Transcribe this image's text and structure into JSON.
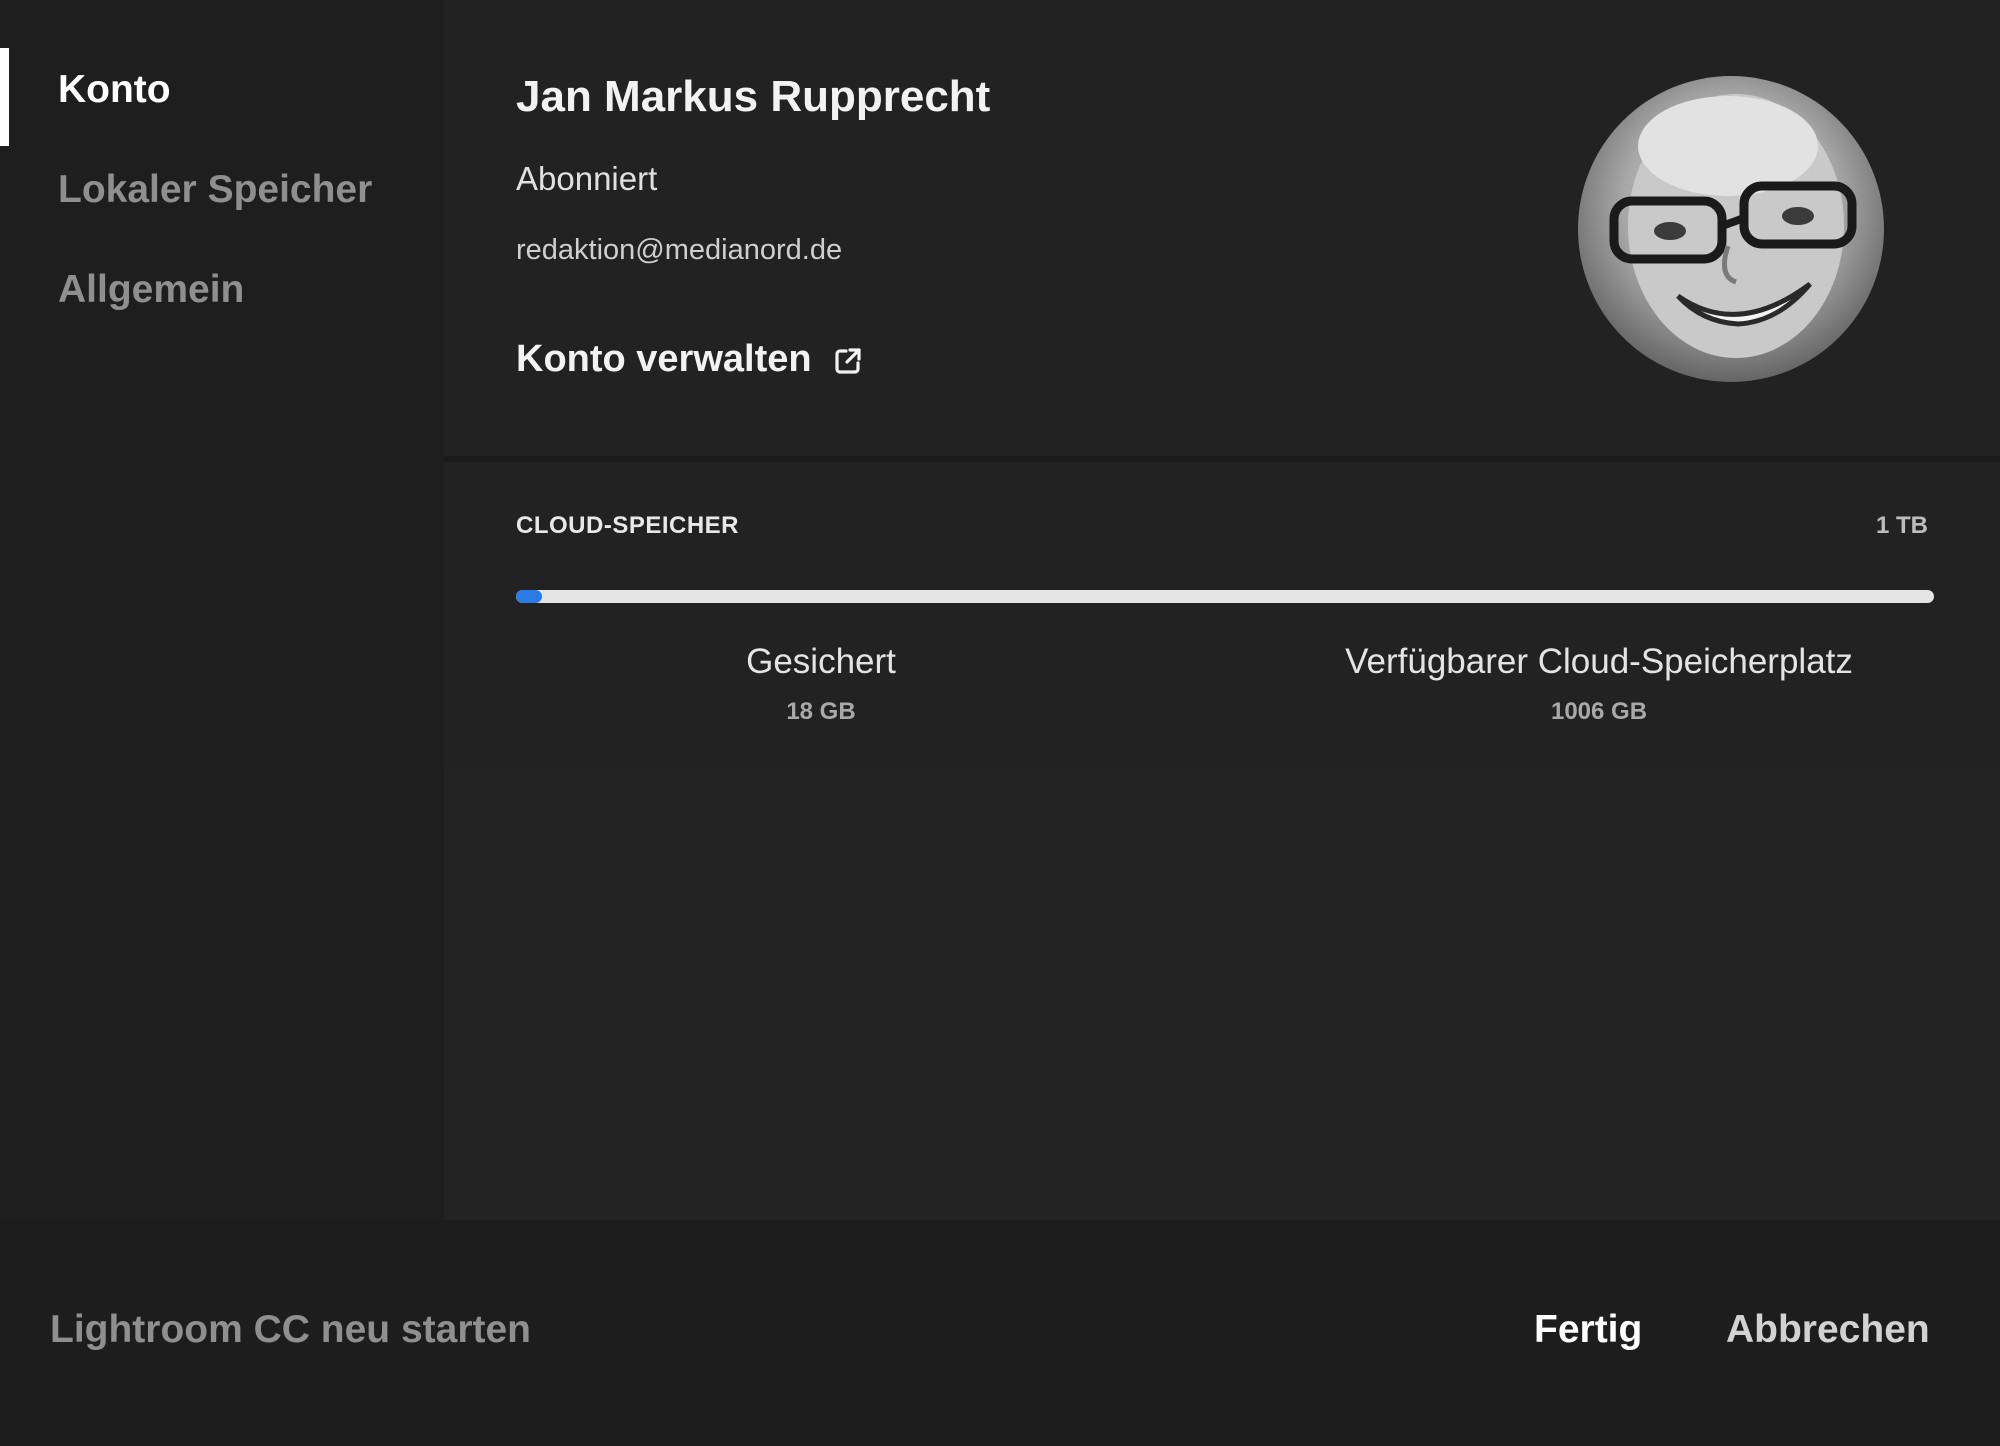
{
  "sidebar": {
    "items": [
      {
        "label": "Konto",
        "active": true
      },
      {
        "label": "Lokaler Speicher",
        "active": false
      },
      {
        "label": "Allgemein",
        "active": false
      }
    ]
  },
  "account": {
    "name": "Jan Markus Rupprecht",
    "status": "Abonniert",
    "email": "redaktion@medianord.de",
    "manage_label": "Konto verwalten",
    "manage_icon": "external-link-icon"
  },
  "storage": {
    "title": "CLOUD-SPEICHER",
    "total": "1 TB",
    "used_fraction": 0.018,
    "saved_label": "Gesichert",
    "saved_value": "18 GB",
    "available_label": "Verfügbarer Cloud-Speicherplatz",
    "available_value": "1006 GB",
    "accent_color": "#2a7be4"
  },
  "footer": {
    "restart_label": "Lightroom CC neu starten",
    "done_label": "Fertig",
    "cancel_label": "Abbrechen"
  }
}
